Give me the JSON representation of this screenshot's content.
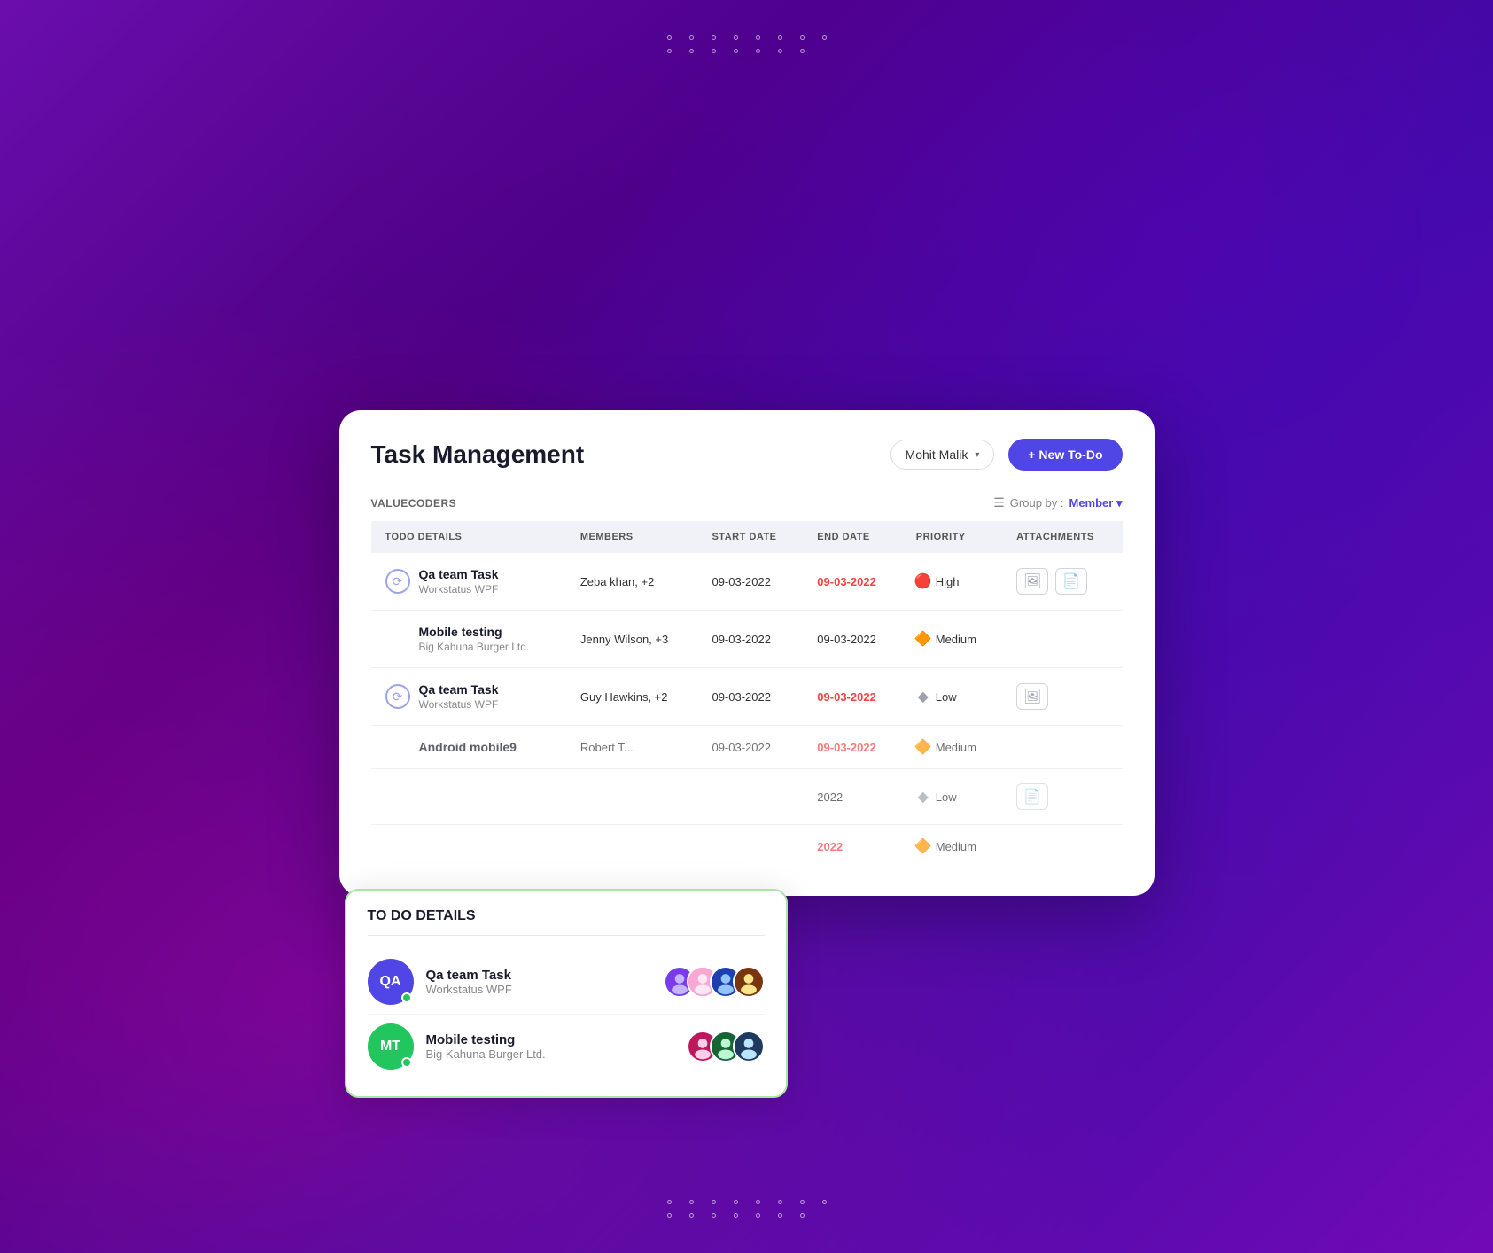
{
  "header": {
    "title": "Task Management",
    "user": "Mohit Malik",
    "new_todo_label": "+ New To-Do"
  },
  "subheader": {
    "org_name": "VALUECODERS",
    "group_by_label": "Group by :",
    "group_by_value": "Member"
  },
  "table": {
    "columns": [
      "TODO DETAILS",
      "MEMBERS",
      "START DATE",
      "END DATE",
      "PRIORITY",
      "ATTACHMENTS"
    ],
    "rows": [
      {
        "id": 1,
        "task_name": "Qa team Task",
        "task_org": "Workstatus WPF",
        "members": "Zeba khan, +2",
        "start_date": "09-03-2022",
        "end_date": "09-03-2022",
        "end_date_red": true,
        "priority": "High",
        "priority_level": "high",
        "has_attachments": true,
        "attachment_types": [
          "image",
          "doc"
        ],
        "has_icon": true
      },
      {
        "id": 2,
        "task_name": "Mobile testing",
        "task_org": "Big Kahuna Burger Ltd.",
        "members": "Jenny Wilson, +3",
        "start_date": "09-03-2022",
        "end_date": "09-03-2022",
        "end_date_red": false,
        "priority": "Medium",
        "priority_level": "medium",
        "has_attachments": false,
        "attachment_types": [],
        "has_icon": false
      },
      {
        "id": 3,
        "task_name": "Qa team Task",
        "task_org": "Workstatus WPF",
        "members": "Guy Hawkins, +2",
        "start_date": "09-03-2022",
        "end_date": "09-03-2022",
        "end_date_red": true,
        "priority": "Low",
        "priority_level": "low",
        "has_attachments": true,
        "attachment_types": [
          "image"
        ],
        "has_icon": true
      },
      {
        "id": 4,
        "task_name": "Android mobile9",
        "task_org": "",
        "members": "Robert T...",
        "start_date": "09-03-2022",
        "end_date": "09-03-2022",
        "end_date_red": true,
        "priority": "Medium",
        "priority_level": "medium",
        "has_attachments": false,
        "attachment_types": [],
        "has_icon": false,
        "partial": true
      },
      {
        "id": 5,
        "task_name": "",
        "task_org": "",
        "members": "",
        "start_date": "",
        "end_date": "2022",
        "end_date_red": false,
        "priority": "Low",
        "priority_level": "low",
        "has_attachments": true,
        "attachment_types": [
          "doc"
        ],
        "has_icon": false,
        "partial": true
      },
      {
        "id": 6,
        "task_name": "",
        "task_org": "",
        "members": "",
        "start_date": "",
        "end_date": "2022",
        "end_date_red": true,
        "priority": "Medium",
        "priority_level": "medium",
        "has_attachments": false,
        "attachment_types": [],
        "has_icon": false,
        "partial": true
      }
    ]
  },
  "tooltip": {
    "title": "TO DO DETAILS",
    "items": [
      {
        "avatar_initials": "QA",
        "avatar_class": "avatar-qa",
        "task_name": "Qa team Task",
        "task_org": "Workstatus WPF",
        "members": 4
      },
      {
        "avatar_initials": "MT",
        "avatar_class": "avatar-mt",
        "task_name": "Mobile testing",
        "task_org": "Big Kahuna Burger Ltd.",
        "members": 3
      }
    ]
  }
}
